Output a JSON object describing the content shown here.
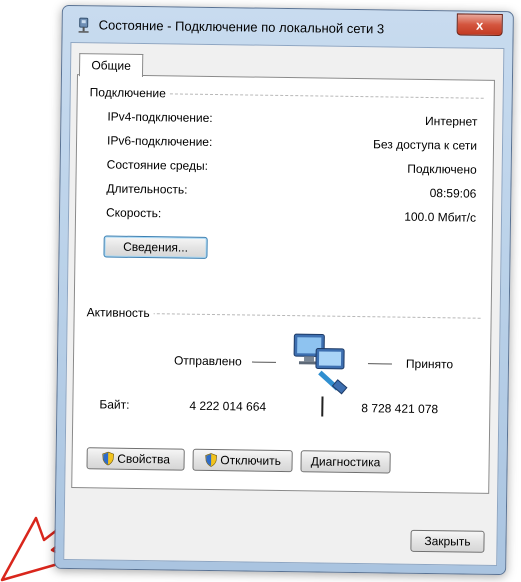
{
  "window": {
    "title": "Состояние - Подключение по локальной сети 3",
    "close_glyph": "x"
  },
  "tabs": [
    {
      "label": "Общие"
    }
  ],
  "connection": {
    "group_label": "Подключение",
    "rows": [
      {
        "label": "IPv4-подключение:",
        "value": "Интернет"
      },
      {
        "label": "IPv6-подключение:",
        "value": "Без доступа к сети"
      },
      {
        "label": "Состояние среды:",
        "value": "Подключено"
      },
      {
        "label": "Длительность:",
        "value": "08:59:06"
      },
      {
        "label": "Скорость:",
        "value": "100.0 Мбит/с"
      }
    ],
    "details_button": "Сведения..."
  },
  "activity": {
    "group_label": "Активность",
    "sent_label": "Отправлено",
    "received_label": "Принято",
    "bytes_label": "Байт:",
    "bytes_sent": "4 222 014 664",
    "bytes_received": "8 728 421 078",
    "icon": "network-computers-icon"
  },
  "buttons": {
    "properties": "Свойства",
    "disable": "Отключить",
    "diagnose": "Диагностика",
    "close": "Закрыть"
  },
  "annotation": {
    "icon": "red-outline-arrow-icon",
    "color": "#d9261c"
  }
}
